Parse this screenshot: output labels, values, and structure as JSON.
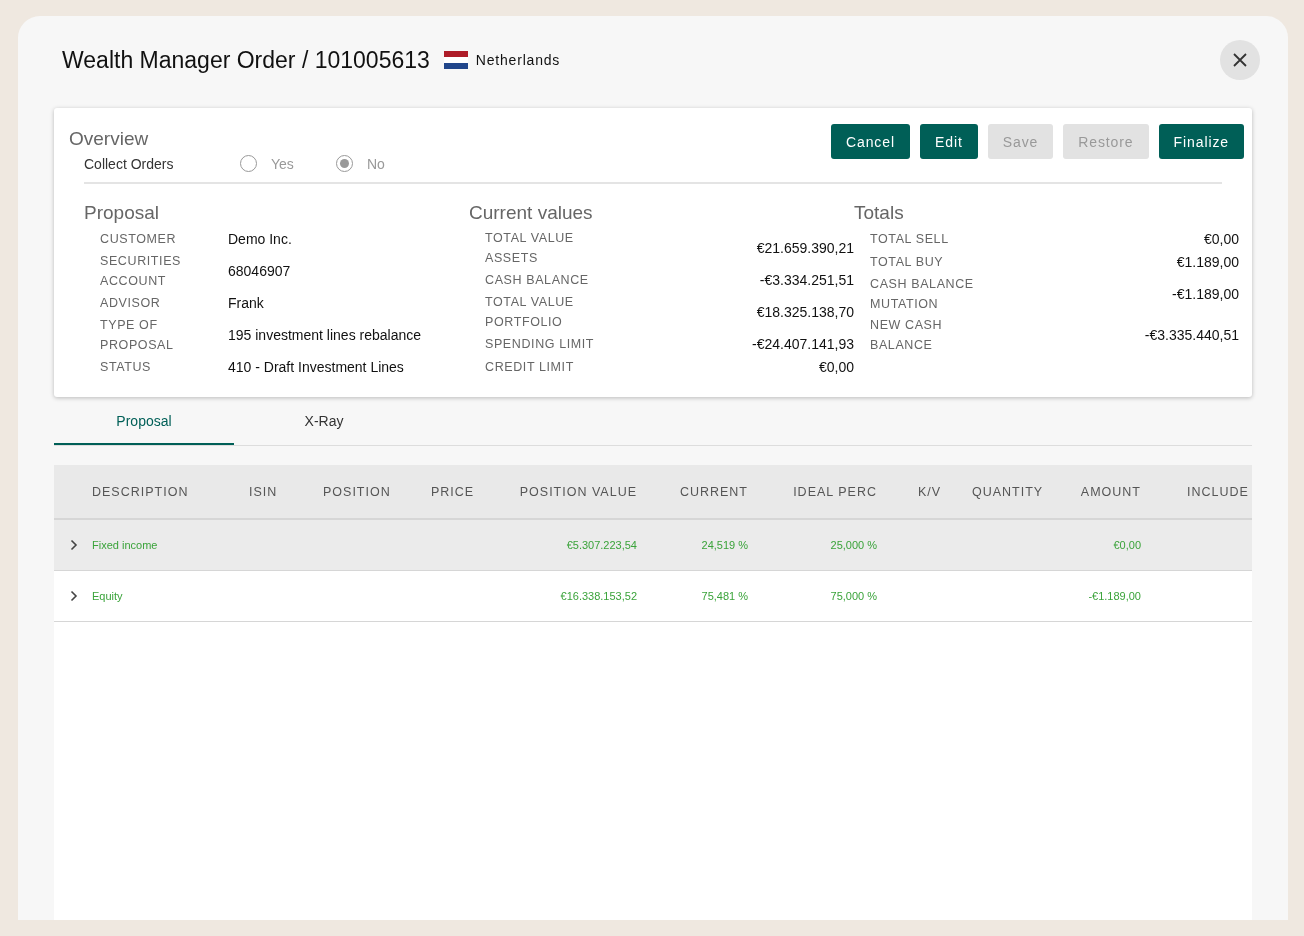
{
  "window": {
    "title": "Wealth Manager Order / 101005613",
    "country": "Netherlands"
  },
  "overview": {
    "title": "Overview",
    "buttons": [
      {
        "label": "Cancel",
        "disabled": false
      },
      {
        "label": "Edit",
        "disabled": false
      },
      {
        "label": "Save",
        "disabled": true
      },
      {
        "label": "Restore",
        "disabled": true
      },
      {
        "label": "Finalize",
        "disabled": false
      }
    ],
    "collect_orders": {
      "label": "Collect Orders",
      "options": [
        {
          "label": "Yes",
          "selected": false
        },
        {
          "label": "No",
          "selected": true
        }
      ]
    },
    "sections": [
      {
        "title": "Proposal",
        "kind": "text",
        "fields": [
          {
            "label": "CUSTOMER",
            "value": "Demo Inc."
          },
          {
            "label": "SECURITIES ACCOUNT",
            "value": "68046907"
          },
          {
            "label": "ADVISOR",
            "value": "Frank"
          },
          {
            "label": "TYPE OF PROPOSAL",
            "value": "195 investment lines rebalance"
          },
          {
            "label": "STATUS",
            "value": "410 - Draft Investment Lines"
          }
        ]
      },
      {
        "title": "Current values",
        "kind": "amount",
        "fields": [
          {
            "label": "TOTAL VALUE ASSETS",
            "value": "€21.659.390,21"
          },
          {
            "label": "CASH BALANCE",
            "value": "-€3.334.251,51"
          },
          {
            "label": "TOTAL VALUE PORTFOLIO",
            "value": "€18.325.138,70"
          },
          {
            "label": "SPENDING LIMIT",
            "value": "-€24.407.141,93"
          },
          {
            "label": "CREDIT LIMIT",
            "value": "€0,00"
          }
        ]
      },
      {
        "title": "Totals",
        "kind": "amount",
        "fields": [
          {
            "label": "TOTAL SELL",
            "value": "€0,00"
          },
          {
            "label": "TOTAL BUY",
            "value": "€1.189,00"
          },
          {
            "label": "CASH BALANCE MUTATION",
            "value": "-€1.189,00"
          },
          {
            "label": "NEW CASH BALANCE",
            "value": "-€3.335.440,51"
          }
        ]
      }
    ]
  },
  "tabs": [
    {
      "label": "Proposal",
      "selected": true
    },
    {
      "label": "X-Ray",
      "selected": false
    }
  ],
  "table": {
    "columns": [
      "DESCRIPTION",
      "ISIN",
      "POSITION",
      "PRICE",
      "POSITION VALUE",
      "CURRENT",
      "IDEAL PERC",
      "K/V",
      "QUANTITY",
      "AMOUNT",
      "INCLUDE"
    ],
    "rows": [
      {
        "description": "Fixed income",
        "position_value": "€5.307.223,54",
        "current": "24,519 %",
        "ideal_perc": "25,000 %",
        "amount": "€0,00",
        "selected": true,
        "expanded": false
      },
      {
        "description": "Equity",
        "position_value": "€16.338.153,52",
        "current": "75,481 %",
        "ideal_perc": "75,000 %",
        "amount": "-€1.189,00",
        "selected": false,
        "expanded": false
      }
    ]
  }
}
